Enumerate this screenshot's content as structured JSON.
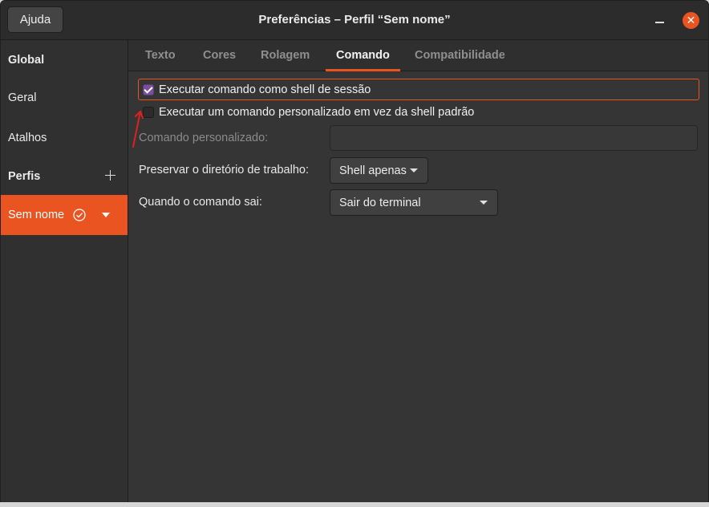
{
  "window": {
    "title": "Preferências – Perfil “Sem nome”",
    "help_label": "Ajuda",
    "accent": "#e95420"
  },
  "sidebar": {
    "global_header": "Global",
    "items": [
      "Geral",
      "Atalhos"
    ],
    "profiles_header": "Perfis",
    "selected_profile": "Sem nome"
  },
  "tabs": [
    {
      "label": "Texto",
      "active": false
    },
    {
      "label": "Cores",
      "active": false
    },
    {
      "label": "Rolagem",
      "active": false
    },
    {
      "label": "Comando",
      "active": true
    },
    {
      "label": "Compatibilidade",
      "active": false
    }
  ],
  "command": {
    "login_shell_label": "Executar comando como shell de sessão",
    "login_shell_checked": true,
    "custom_command_label": "Executar um comando personalizado em vez da shell padrão",
    "custom_command_checked": false,
    "custom_command_field_label": "Comando personalizado:",
    "custom_command_value": "",
    "preserve_dir_label": "Preservar o diretório de trabalho:",
    "preserve_dir_value": "Shell apenas",
    "on_exit_label": "Quando o comando sai:",
    "on_exit_value": "Sair do terminal"
  }
}
